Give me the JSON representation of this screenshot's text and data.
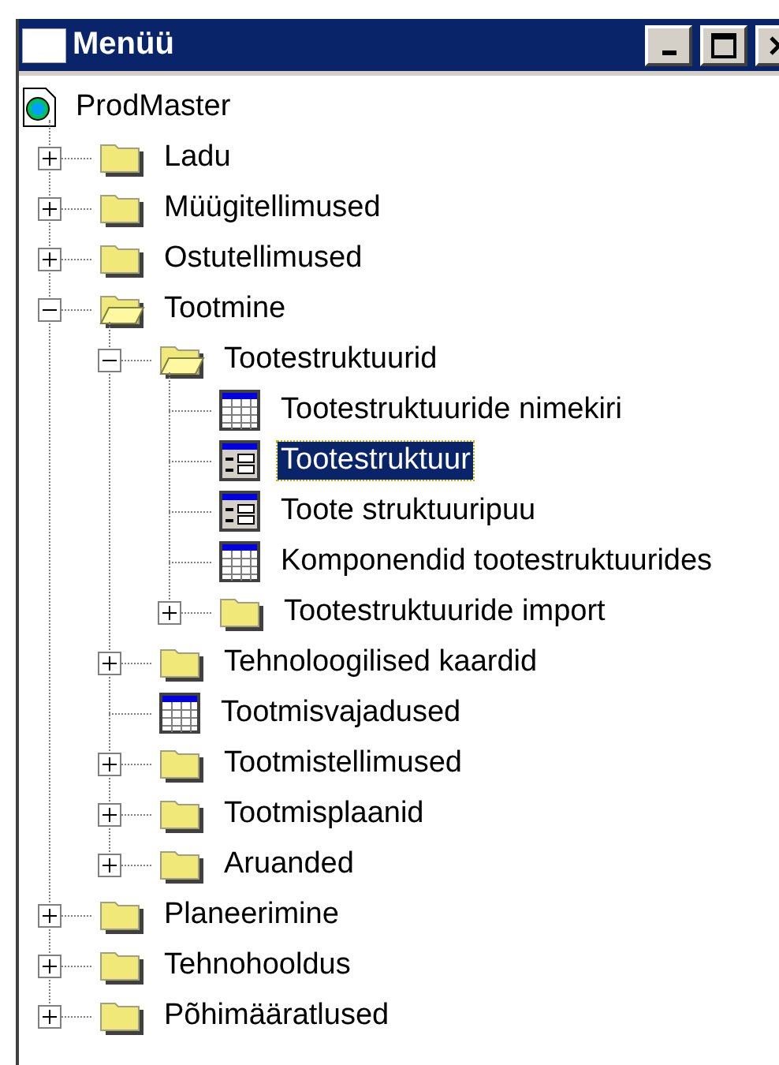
{
  "window": {
    "title": "Menüü"
  },
  "tree": [
    {
      "label": "ProdMaster",
      "kind": "root",
      "selected": false,
      "expanded": true,
      "children": [
        {
          "label": "Ladu",
          "kind": "folder",
          "selected": false,
          "expanded": false
        },
        {
          "label": "Müügitellimused",
          "kind": "folder",
          "selected": false,
          "expanded": false
        },
        {
          "label": "Ostutellimused",
          "kind": "folder",
          "selected": false,
          "expanded": false
        },
        {
          "label": "Tootmine",
          "kind": "folder",
          "selected": false,
          "expanded": true,
          "children": [
            {
              "label": "Tootestruktuurid",
              "kind": "folder",
              "selected": false,
              "expanded": true,
              "children": [
                {
                  "label": "Tootestruktuuride nimekiri",
                  "kind": "table",
                  "selected": false
                },
                {
                  "label": "Tootestruktuur",
                  "kind": "form",
                  "selected": true
                },
                {
                  "label": "Toote struktuuripuu",
                  "kind": "form",
                  "selected": false
                },
                {
                  "label": "Komponendid tootestruktuurides",
                  "kind": "table",
                  "selected": false
                },
                {
                  "label": "Tootestruktuuride import",
                  "kind": "folder",
                  "selected": false,
                  "expanded": false
                }
              ]
            },
            {
              "label": "Tehnoloogilised kaardid",
              "kind": "folder",
              "selected": false,
              "expanded": false
            },
            {
              "label": "Tootmisvajadused",
              "kind": "table",
              "selected": false
            },
            {
              "label": "Tootmistellimused",
              "kind": "folder",
              "selected": false,
              "expanded": false
            },
            {
              "label": "Tootmisplaanid",
              "kind": "folder",
              "selected": false,
              "expanded": false
            },
            {
              "label": "Aruanded",
              "kind": "folder",
              "selected": false,
              "expanded": false
            }
          ]
        },
        {
          "label": "Planeerimine",
          "kind": "folder",
          "selected": false,
          "expanded": false
        },
        {
          "label": "Tehnohooldus",
          "kind": "folder",
          "selected": false,
          "expanded": false
        },
        {
          "label": "Põhimääratlused",
          "kind": "folder",
          "selected": false,
          "expanded": false
        }
      ]
    }
  ]
}
